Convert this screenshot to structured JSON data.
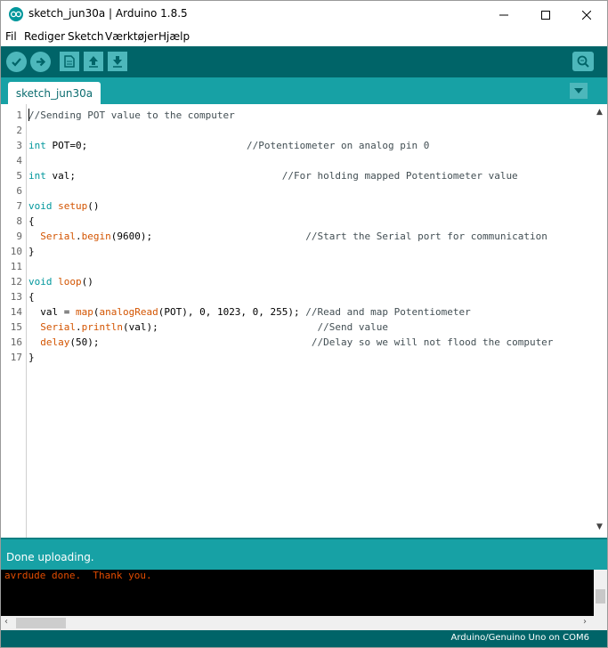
{
  "window": {
    "title": "sketch_jun30a | Arduino 1.8.5"
  },
  "menu": [
    "Fil",
    "Rediger",
    "Sketch",
    "Værktøjer",
    "Hjælp"
  ],
  "toolbar": {
    "buttons": [
      "verify-icon",
      "upload-icon",
      "new-icon",
      "open-icon",
      "save-icon"
    ],
    "serial_monitor": "serial-monitor-icon"
  },
  "tabs": [
    {
      "label": "sketch_jun30a",
      "active": true
    }
  ],
  "editor": {
    "line_numbers": [
      "1",
      "2",
      "3",
      "4",
      "5",
      "6",
      "7",
      "8",
      "9",
      "10",
      "11",
      "12",
      "13",
      "14",
      "15",
      "16",
      "17"
    ]
  },
  "status": {
    "message": "Done uploading."
  },
  "console": {
    "output": "avrdude done.  Thank you."
  },
  "footer": {
    "board": "Arduino/Genuino Uno on COM6"
  },
  "colors": {
    "toolbar": "#006468",
    "tabrow": "#17a1a5",
    "keyword": "#00979c",
    "function": "#d35400",
    "console_text": "#e34c00"
  }
}
